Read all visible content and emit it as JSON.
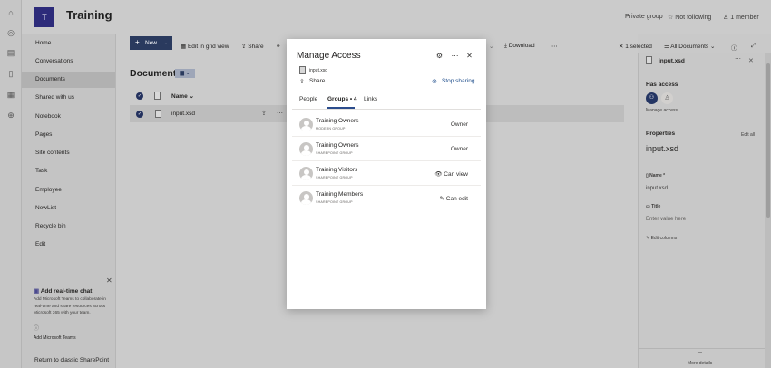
{
  "site": {
    "logo_letter": "T",
    "title": "Training",
    "privacy": "Private group",
    "follow": "Not following",
    "members": "1 member"
  },
  "nav": {
    "items": [
      "Home",
      "Conversations",
      "Documents",
      "Shared with us",
      "Notebook",
      "Pages",
      "Site contents",
      "Task",
      "Employee",
      "NewList",
      "Recycle bin",
      "Edit"
    ],
    "selected": "Documents"
  },
  "chat_card": {
    "title": "Add real-time chat",
    "description": "Add Microsoft Teams to collaborate in real-time and share resources across Microsoft 365 with your team.",
    "link": "Add Microsoft Teams"
  },
  "return_link": "Return to classic SharePoint",
  "commandbar": {
    "new": "New",
    "edit_grid": "Edit in grid view",
    "share": "Share",
    "download": "Download",
    "selected": "1 selected",
    "view": "All Documents"
  },
  "library": {
    "title": "Documents",
    "column_name": "Name",
    "file": "input.xsd"
  },
  "pane": {
    "file": "input.xsd",
    "has_access": "Has access",
    "manage_access": "Manage access",
    "properties": "Properties",
    "edit_all": "Edit all",
    "name_label": "Name",
    "name_value": "input.xsd",
    "title_label": "Title",
    "title_placeholder": "Enter value here",
    "edit_columns": "Edit columns",
    "more_details": "More details"
  },
  "dialog": {
    "title": "Manage Access",
    "file": "input.xsd",
    "share": "Share",
    "stop_sharing": "Stop sharing",
    "tabs": [
      "People",
      "Groups • 4",
      "Links"
    ],
    "groups": [
      {
        "name": "Training Owners",
        "type": "MODERN GROUP",
        "role": "Owner"
      },
      {
        "name": "Training Owners",
        "type": "SHAREPOINT GROUP",
        "role": "Owner"
      },
      {
        "name": "Training Visitors",
        "type": "SHAREPOINT GROUP",
        "role": "Can view"
      },
      {
        "name": "Training Members",
        "type": "SHAREPOINT GROUP",
        "role": "Can edit"
      }
    ]
  }
}
